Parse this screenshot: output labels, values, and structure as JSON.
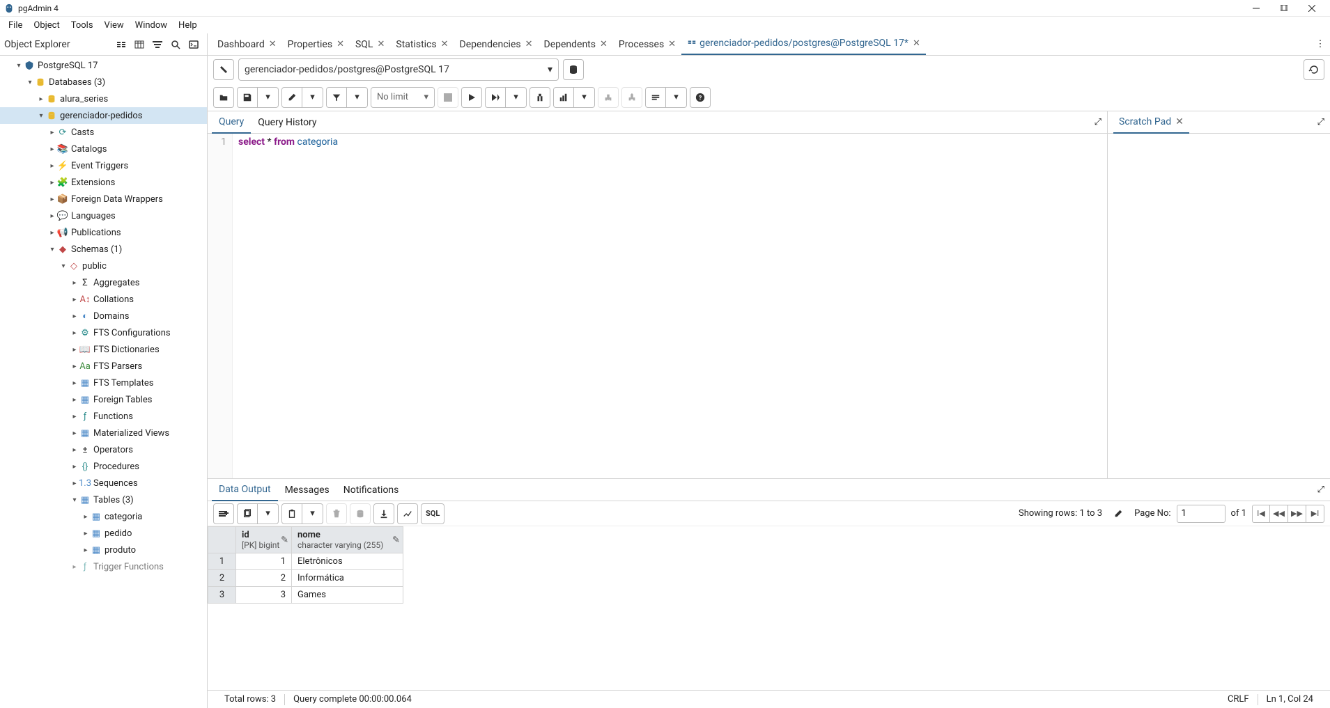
{
  "app_title": "pgAdmin 4",
  "menu": [
    "File",
    "Object",
    "Tools",
    "View",
    "Window",
    "Help"
  ],
  "sidebar": {
    "title": "Object Explorer"
  },
  "tree": {
    "server": "PostgreSQL 17",
    "databases_label": "Databases (3)",
    "db1": "alura_series",
    "db2": "gerenciador-pedidos",
    "casts": "Casts",
    "catalogs": "Catalogs",
    "event_triggers": "Event Triggers",
    "extensions": "Extensions",
    "fdw": "Foreign Data Wrappers",
    "languages": "Languages",
    "publications": "Publications",
    "schemas": "Schemas (1)",
    "public": "public",
    "aggregates": "Aggregates",
    "collations": "Collations",
    "domains": "Domains",
    "fts_conf": "FTS Configurations",
    "fts_dict": "FTS Dictionaries",
    "fts_parsers": "FTS Parsers",
    "fts_templates": "FTS Templates",
    "foreign_tables": "Foreign Tables",
    "functions": "Functions",
    "mat_views": "Materialized Views",
    "operators": "Operators",
    "procedures": "Procedures",
    "sequences": "Sequences",
    "tables": "Tables (3)",
    "t_categoria": "categoria",
    "t_pedido": "pedido",
    "t_produto": "produto",
    "trigger_fn": "Trigger Functions"
  },
  "tabs": {
    "dashboard": "Dashboard",
    "properties": "Properties",
    "sql": "SQL",
    "statistics": "Statistics",
    "dependencies": "Dependencies",
    "dependents": "Dependents",
    "processes": "Processes",
    "active": "gerenciador-pedidos/postgres@PostgreSQL 17*"
  },
  "connection": "gerenciador-pedidos/postgres@PostgreSQL 17",
  "limit": "No limit",
  "qtabs": {
    "query": "Query",
    "history": "Query History"
  },
  "sql": {
    "select": "select",
    "star": "*",
    "from": "from",
    "table": "categoria"
  },
  "scratch": "Scratch Pad",
  "otabs": {
    "data": "Data Output",
    "messages": "Messages",
    "notifications": "Notifications"
  },
  "paging": {
    "showing": "Showing rows: 1 to 3",
    "pageno_label": "Page No:",
    "pageno": "1",
    "of": "of 1"
  },
  "columns": {
    "id_name": "id",
    "id_type": "[PK] bigint",
    "nome_name": "nome",
    "nome_type": "character varying (255)"
  },
  "rows": [
    {
      "n": "1",
      "id": "1",
      "nome": "Eletrônicos"
    },
    {
      "n": "2",
      "id": "2",
      "nome": "Informática"
    },
    {
      "n": "3",
      "id": "3",
      "nome": "Games"
    }
  ],
  "status": {
    "total": "Total rows: 3",
    "complete": "Query complete 00:00:00.064",
    "crlf": "CRLF",
    "pos": "Ln 1, Col 24"
  }
}
